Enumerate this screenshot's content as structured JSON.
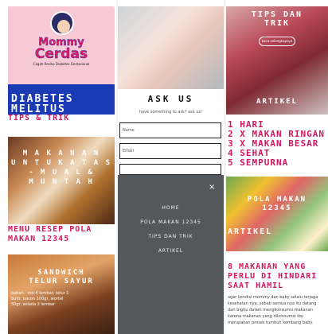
{
  "logo": {
    "line1": "Mommy",
    "line2": "Cerdas",
    "tagline": "Cegah Resiko Diabetes Gestasional"
  },
  "banner": {
    "title_line1": "DIABETES",
    "title_line2": "MELITUS",
    "section_label": "TIPS & TRIK"
  },
  "food_card_1": {
    "overlay_line1": "M A K A N A N",
    "overlay_line2": "U N T U K  A T A S",
    "overlay_line3": "- M U A L &",
    "overlay_line4": "M U N T A H",
    "caption_line1": "MENU RESEP POLA",
    "caption_line2": "MAKAN 12345"
  },
  "food_card_2": {
    "overlay_line1": "SANDWICH",
    "overlay_line2": "TELUR SAYUR",
    "text_1": "bahan : roti 4 lembar, telur 1",
    "text_2": "butir, bacon 100gr, wortel",
    "text_3": "50gr, selada 2 lembar"
  },
  "ask": {
    "title": "ASK US",
    "subtitle": "have something to ask? ask us!",
    "name_placeholder": "Name",
    "email_placeholder": "Email"
  },
  "menu": {
    "close": "×",
    "items": [
      "HOME",
      "POLA MAKAN 12345",
      "TIPS DAN TRIK",
      "ARTIKEL"
    ]
  },
  "tips_card": {
    "title_line1": "TIPS DAN",
    "title_line2": "TRIK",
    "button": "baca selengkapnya",
    "artikel_label": "ARTIKEL"
  },
  "meal_list": [
    "1 HARI",
    "2 X MAKAN RINGAN",
    "3 X MAKAN BESAR",
    "4 SEHAT",
    "5 SEMPURNA"
  ],
  "veg_card": {
    "title_line1": "POLA MAKAN",
    "title_line2": "12345",
    "artikel_label": "ARTIKEL"
  },
  "article": {
    "head_line1": "8 MAKANAN YANG",
    "head_line2": "PERLU DI HINDARI",
    "head_line3": "SAAT HAMIL",
    "body_line1": "agar kondisi mommy dan baby selalu terjaga",
    "body_line2": "kesehatan nya, sebab semua nya itu datang",
    "body_line3": "dari bigitu dalam mengkonsumsi makanan",
    "body_line4": "karena makanan yang dikonsumsi ibu",
    "body_line5": "merupakan proses tumbuh kembang baby."
  }
}
